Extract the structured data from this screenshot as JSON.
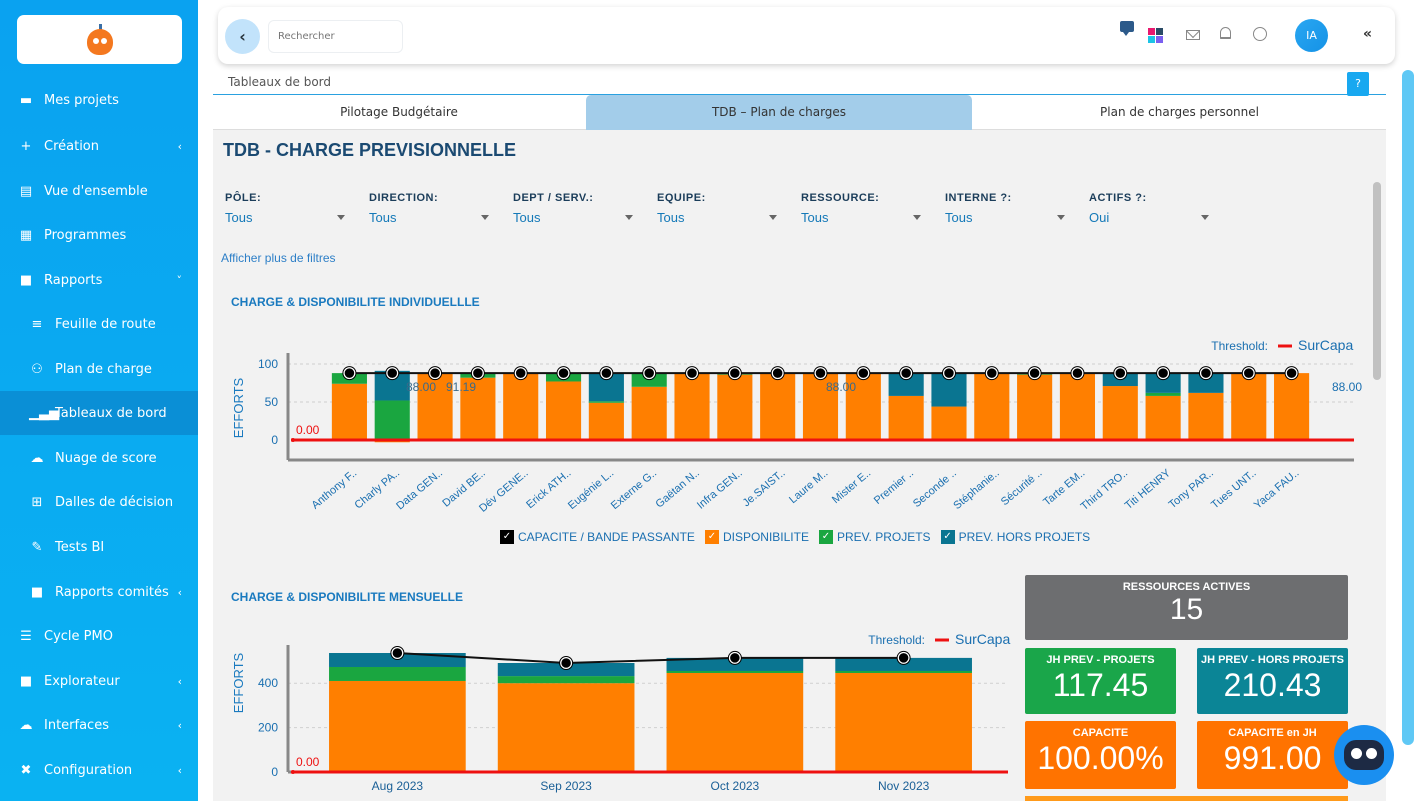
{
  "sidebar": {
    "items": [
      {
        "label": "Mes projets",
        "icon": "briefcase-icon",
        "glyph": "▬",
        "sub": false,
        "chevron": ""
      },
      {
        "label": "Création",
        "icon": "plus-icon",
        "glyph": "+",
        "sub": false,
        "chevron": "‹"
      },
      {
        "label": "Vue d'ensemble",
        "icon": "clipboard-icon",
        "glyph": "▤",
        "sub": false,
        "chevron": ""
      },
      {
        "label": "Programmes",
        "icon": "list-icon",
        "glyph": "▦",
        "sub": false,
        "chevron": ""
      },
      {
        "label": "Rapports",
        "icon": "file-icon",
        "glyph": "■",
        "sub": false,
        "chevron": "˅"
      },
      {
        "label": "Feuille de route",
        "icon": "align-icon",
        "glyph": "≡",
        "sub": true,
        "chevron": ""
      },
      {
        "label": "Plan de charge",
        "icon": "users-icon",
        "glyph": "⚇",
        "sub": true,
        "chevron": ""
      },
      {
        "label": "Tableaux de bord",
        "icon": "bar-chart-icon",
        "glyph": "▁▃▅",
        "sub": true,
        "chevron": "",
        "active": true
      },
      {
        "label": "Nuage de score",
        "icon": "cloud-icon",
        "glyph": "☁",
        "sub": true,
        "chevron": ""
      },
      {
        "label": "Dalles de décision",
        "icon": "table-icon",
        "glyph": "⊞",
        "sub": true,
        "chevron": ""
      },
      {
        "label": "Tests BI",
        "icon": "eyedropper-icon",
        "glyph": "✎",
        "sub": true,
        "chevron": ""
      },
      {
        "label": "Rapports comités",
        "icon": "file-icon",
        "glyph": "■",
        "sub": true,
        "chevron": "‹"
      },
      {
        "label": "Cycle PMO",
        "icon": "checklist-icon",
        "glyph": "☰",
        "sub": false,
        "chevron": ""
      },
      {
        "label": "Explorateur",
        "icon": "file-download-icon",
        "glyph": "■",
        "sub": false,
        "chevron": "‹"
      },
      {
        "label": "Interfaces",
        "icon": "cloud-icon",
        "glyph": "☁",
        "sub": false,
        "chevron": "‹"
      },
      {
        "label": "Configuration",
        "icon": "tools-icon",
        "glyph": "✖",
        "sub": false,
        "chevron": "‹"
      }
    ]
  },
  "topbar": {
    "search_placeholder": "Rechercher",
    "back_glyph": "‹",
    "avatar_initials": "IA",
    "collapse_glyph": "«",
    "icons": [
      "chat-icon",
      "apps-grid-icon",
      "mail-icon",
      "bell-icon",
      "clock-icon"
    ],
    "grid_colors": [
      "#e8196f",
      "#2a4a66",
      "#1cc4e6",
      "#7a5ff0"
    ]
  },
  "breadcrumb": "Tableaux de bord",
  "help_label": "?",
  "tabs": [
    {
      "label": "Pilotage Budgétaire",
      "active": false
    },
    {
      "label": "TDB – Plan de charges",
      "active": true
    },
    {
      "label": "Plan de charges personnel",
      "active": false
    }
  ],
  "page_title": "TDB - CHARGE PREVISIONNELLE",
  "filters": [
    {
      "label": "PÔLE:",
      "value": "Tous"
    },
    {
      "label": "DIRECTION:",
      "value": "Tous"
    },
    {
      "label": "DEPT / SERV.:",
      "value": "Tous"
    },
    {
      "label": "EQUIPE:",
      "value": "Tous"
    },
    {
      "label": "RESSOURCE:",
      "value": "Tous"
    },
    {
      "label": "INTERNE ?:",
      "value": "Tous"
    },
    {
      "label": "ACTIFS ?:",
      "value": "Oui"
    }
  ],
  "more_filters": "Afficher plus de filtres",
  "colors": {
    "disponibilite": "#ff7f00",
    "prev_projets": "#1aa640",
    "prev_hors_projets": "#0a7591",
    "capacite": "#000000",
    "threshold": "#ee1111",
    "accent": "#0aa2f0"
  },
  "legend": [
    {
      "label": "CAPACITE / BANDE PASSANTE",
      "color": "#000000",
      "check": "✓"
    },
    {
      "label": "DISPONIBILITE",
      "color": "#ff7f00",
      "check": "✓"
    },
    {
      "label": "PREV. PROJETS",
      "color": "#1aa640",
      "check": "✓"
    },
    {
      "label": "PREV. HORS PROJETS",
      "color": "#0a7591",
      "check": "✓"
    }
  ],
  "chart_data": [
    {
      "type": "bar",
      "stacked": true,
      "title": "CHARGE & DISPONIBILITE INDIVIDUELLLE",
      "ylabel": "EFFORTS",
      "xlabel": "",
      "ylim": [
        -10,
        110
      ],
      "yticks": [
        0,
        50,
        100
      ],
      "grid": true,
      "threshold": {
        "label": "Threshold:",
        "name": "SurCapa",
        "value": 0,
        "value_label": "0.00"
      },
      "annotations": [
        "88.00",
        "91.19",
        "88.00",
        "88.00"
      ],
      "categories": [
        "Anthony F..",
        "Charly PA..",
        "Data GEN..",
        "David BE..",
        "Dév GENE..",
        "Erick ATH..",
        "Eugénie L..",
        "Externe G..",
        "Gaëtan N..",
        "Infra GEN..",
        "Je.SAIST..",
        "Laure M..",
        "Mister E..",
        "Premier ..",
        "Seconde ..",
        "Stéphanie..",
        "Sécurité ..",
        "Tarte EM..",
        "Third TRO..",
        "Titi HENRY",
        "Tony PAR..",
        "Tues UNT..",
        "Yaca FAU.."
      ],
      "series": [
        {
          "name": "DISPONIBILITE",
          "values": [
            74,
            -3,
            88,
            82,
            88,
            77,
            49,
            70,
            88,
            86,
            88,
            88,
            88,
            58,
            44,
            88,
            86,
            88,
            71,
            58,
            62,
            88,
            88
          ]
        },
        {
          "name": "PREV. PROJETS",
          "values": [
            14,
            52,
            0,
            6,
            0,
            11,
            2,
            18,
            0,
            2,
            0,
            0,
            0,
            0,
            0,
            0,
            2,
            0,
            0,
            4,
            0,
            0,
            0
          ]
        },
        {
          "name": "PREV. HORS PROJETS",
          "values": [
            0,
            39,
            0,
            0,
            0,
            0,
            37,
            0,
            0,
            0,
            0,
            0,
            0,
            30,
            44,
            0,
            0,
            0,
            17,
            26,
            26,
            0,
            0
          ]
        },
        {
          "name": "CAPACITE / BANDE PASSANTE",
          "type": "line",
          "values": [
            88,
            88,
            88,
            88,
            88,
            88,
            88,
            88,
            88,
            88,
            88,
            88,
            88,
            88,
            88,
            88,
            88,
            88,
            88,
            88,
            88,
            88,
            88
          ]
        }
      ]
    },
    {
      "type": "bar",
      "stacked": true,
      "title": "CHARGE & DISPONIBILITE MENSUELLE",
      "ylabel": "EFFORTS",
      "xlabel": "",
      "ylim": [
        0,
        560
      ],
      "yticks": [
        0,
        200,
        400
      ],
      "grid": true,
      "threshold": {
        "label": "Threshold:",
        "name": "SurCapa",
        "value": 0,
        "value_label": "0.00"
      },
      "categories": [
        "Aug 2023",
        "Sep 2023",
        "Oct 2023",
        "Nov 2023"
      ],
      "series": [
        {
          "name": "DISPONIBILITE",
          "values": [
            410,
            400,
            446,
            446
          ]
        },
        {
          "name": "PREV. PROJETS",
          "values": [
            63,
            32,
            9,
            9
          ]
        },
        {
          "name": "PREV. HORS PROJETS",
          "values": [
            63,
            59,
            59,
            59
          ]
        },
        {
          "name": "CAPACITE / BANDE PASSANTE",
          "type": "line",
          "values": [
            536,
            491,
            514,
            514
          ]
        }
      ]
    }
  ],
  "kpis": [
    {
      "title": "RESSOURCES ACTIVES",
      "value": "15",
      "color": "#6d6e70"
    },
    {
      "title": "JH PREV - PROJETS",
      "value": "117.45",
      "color": "#1aa64a"
    },
    {
      "title": "JH PREV - HORS PROJETS",
      "value": "210.43",
      "color": "#0b8596"
    },
    {
      "title": "CAPACITE",
      "value": "100.00%",
      "color": "#ff7300"
    },
    {
      "title": "CAPACITE en JH",
      "value": "991.00",
      "color": "#ff7300"
    }
  ]
}
